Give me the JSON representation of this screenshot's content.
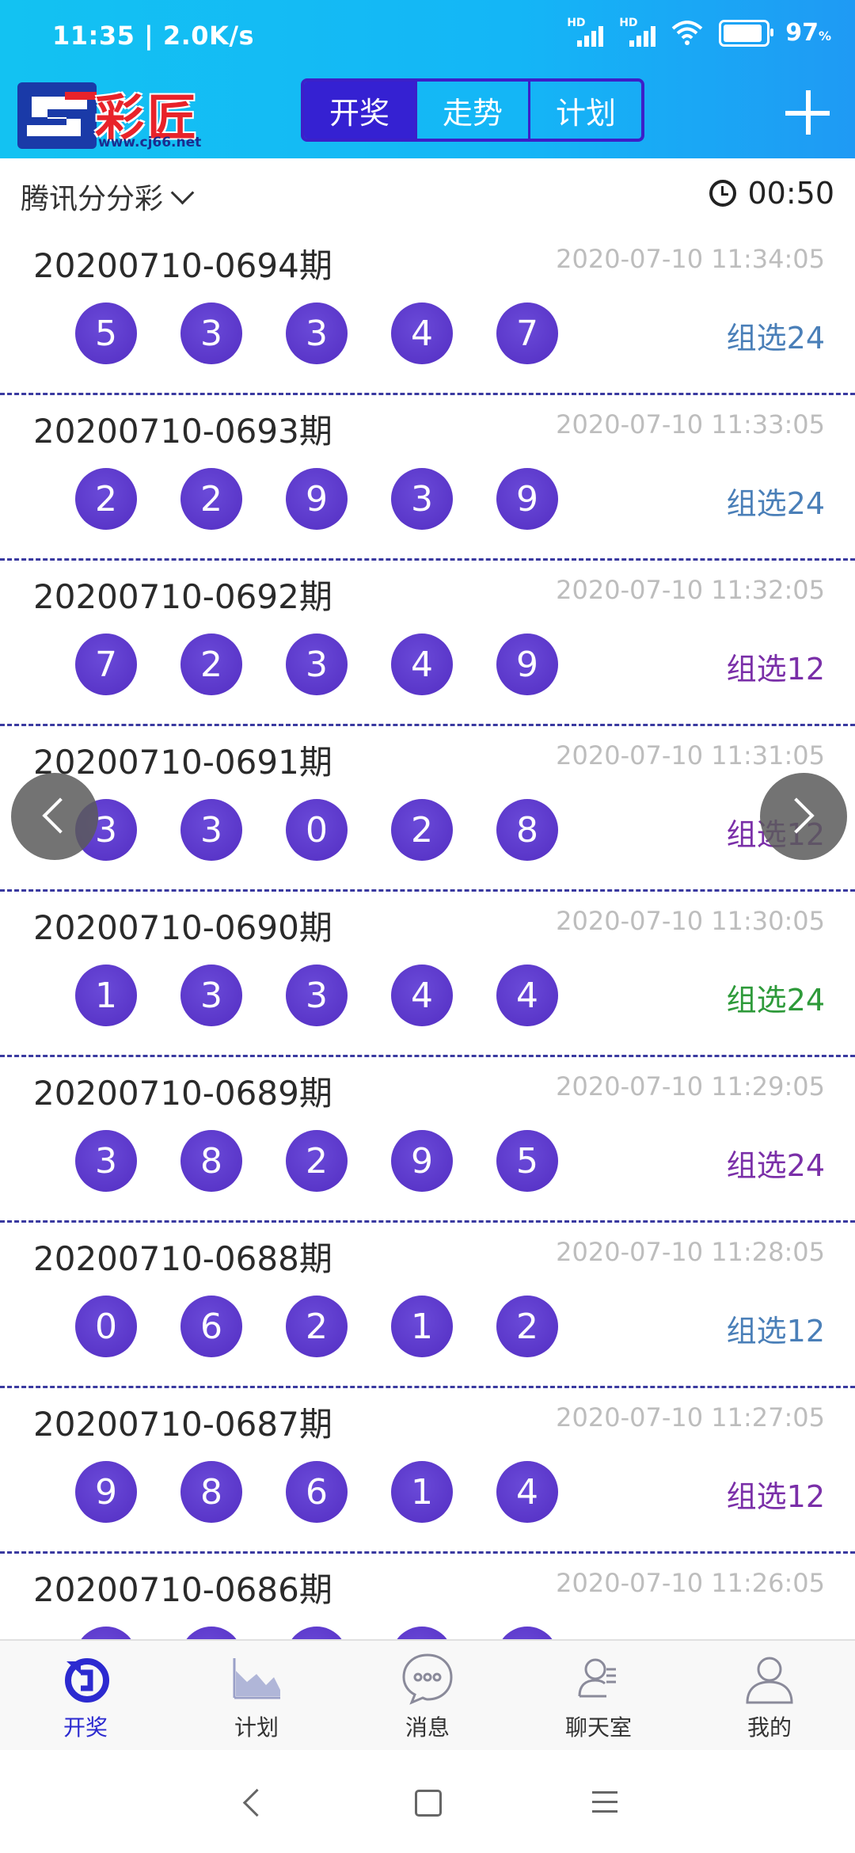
{
  "status_bar": {
    "time_speed": "11:35 | 2.0K/s",
    "network_badge": "HD",
    "battery": "97",
    "battery_unit": "%"
  },
  "header": {
    "logo_text": "彩匠",
    "logo_url": "www.cj66.net",
    "tabs": [
      {
        "label": "开奖",
        "active": true
      },
      {
        "label": "走势",
        "active": false
      },
      {
        "label": "计划",
        "active": false
      }
    ]
  },
  "selector": {
    "lottery": "腾讯分分彩",
    "countdown": "00:50"
  },
  "draws": [
    {
      "issue": "20200710-0694期",
      "time": "2020-07-10 11:34:05",
      "balls": [
        "5",
        "3",
        "3",
        "4",
        "7"
      ],
      "group": "组选24",
      "group_color": "#4a7fb8"
    },
    {
      "issue": "20200710-0693期",
      "time": "2020-07-10 11:33:05",
      "balls": [
        "2",
        "2",
        "9",
        "3",
        "9"
      ],
      "group": "组选24",
      "group_color": "#4a7fb8"
    },
    {
      "issue": "20200710-0692期",
      "time": "2020-07-10 11:32:05",
      "balls": [
        "7",
        "2",
        "3",
        "4",
        "9"
      ],
      "group": "组选12",
      "group_color": "#7a2fa8"
    },
    {
      "issue": "20200710-0691期",
      "time": "2020-07-10 11:31:05",
      "balls": [
        "3",
        "3",
        "0",
        "2",
        "8"
      ],
      "group": "组选12",
      "group_color": "#7a2fa8"
    },
    {
      "issue": "20200710-0690期",
      "time": "2020-07-10 11:30:05",
      "balls": [
        "1",
        "3",
        "3",
        "4",
        "4"
      ],
      "group": "组选24",
      "group_color": "#2e9a3a"
    },
    {
      "issue": "20200710-0689期",
      "time": "2020-07-10 11:29:05",
      "balls": [
        "3",
        "8",
        "2",
        "9",
        "5"
      ],
      "group": "组选24",
      "group_color": "#7a2fa8"
    },
    {
      "issue": "20200710-0688期",
      "time": "2020-07-10 11:28:05",
      "balls": [
        "0",
        "6",
        "2",
        "1",
        "2"
      ],
      "group": "组选12",
      "group_color": "#4a7fb8"
    },
    {
      "issue": "20200710-0687期",
      "time": "2020-07-10 11:27:05",
      "balls": [
        "9",
        "8",
        "6",
        "1",
        "4"
      ],
      "group": "组选12",
      "group_color": "#7a2fa8"
    },
    {
      "issue": "20200710-0686期",
      "time": "2020-07-10 11:26:05",
      "balls": [
        "",
        "",
        "",
        "",
        ""
      ],
      "group": "",
      "group_color": "#4a7fb8"
    }
  ],
  "bottom_nav": [
    {
      "label": "开奖",
      "icon": "lottery-icon",
      "active": true
    },
    {
      "label": "计划",
      "icon": "chart-icon",
      "active": false
    },
    {
      "label": "消息",
      "icon": "message-icon",
      "active": false
    },
    {
      "label": "聊天室",
      "icon": "chatroom-icon",
      "active": false
    },
    {
      "label": "我的",
      "icon": "profile-icon",
      "active": false
    }
  ]
}
